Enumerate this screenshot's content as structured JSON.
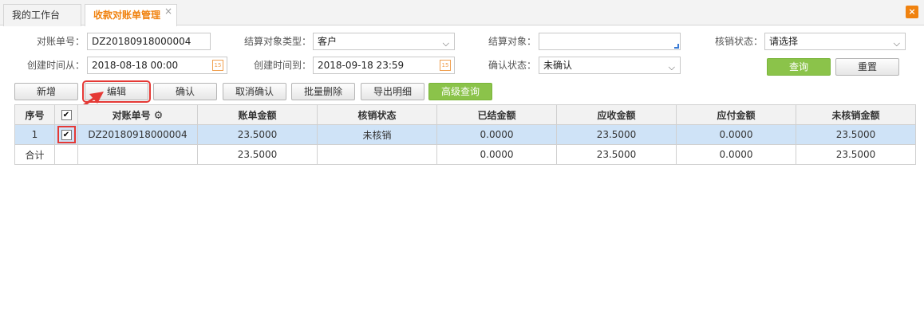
{
  "tabs": [
    {
      "label": "我的工作台"
    },
    {
      "label": "收款对账单管理",
      "close": "×"
    }
  ],
  "window_close": "×",
  "filters": {
    "bill_no": {
      "label": "对账单号：",
      "value": "DZ20180918000004"
    },
    "settle_type": {
      "label": "结算对象类型：",
      "value": "客户"
    },
    "settle_target": {
      "label": "结算对象：",
      "value": ""
    },
    "verify_status": {
      "label": "核销状态：",
      "value": "请选择"
    },
    "created_from": {
      "label": "创建时间从：",
      "value": "2018-08-18 00:00"
    },
    "created_to": {
      "label": "创建时间到：",
      "value": "2018-09-18 23:59"
    },
    "confirm_status": {
      "label": "确认状态：",
      "value": "未确认"
    },
    "calendar_text": "15"
  },
  "buttons": {
    "query": "查询",
    "reset": "重置",
    "add": "新增",
    "edit": "编辑",
    "confirm": "确认",
    "cancel_confirm": "取消确认",
    "batch_delete": "批量删除",
    "export_detail": "导出明细",
    "advanced_query": "高级查询"
  },
  "table": {
    "headers": [
      "序号",
      "",
      "对账单号",
      "账单金额",
      "核销状态",
      "已结金额",
      "应收金额",
      "应付金额",
      "未核销金额"
    ],
    "rows": [
      {
        "index": "1",
        "checked": "✔",
        "bill_no": "DZ20180918000004",
        "amount": "23.5000",
        "status": "未核销",
        "settled": "0.0000",
        "receivable": "23.5000",
        "payable": "0.0000",
        "unverified": "23.5000"
      }
    ],
    "total": {
      "label": "合计",
      "amount": "23.5000",
      "settled": "0.0000",
      "receivable": "23.5000",
      "payable": "0.0000",
      "unverified": "23.5000"
    },
    "header_checked": "✔"
  },
  "colors": {
    "accent": "#f0820f",
    "green": "#8bc34a",
    "highlight": "#e53935",
    "selected_row": "#cfe3f7"
  }
}
